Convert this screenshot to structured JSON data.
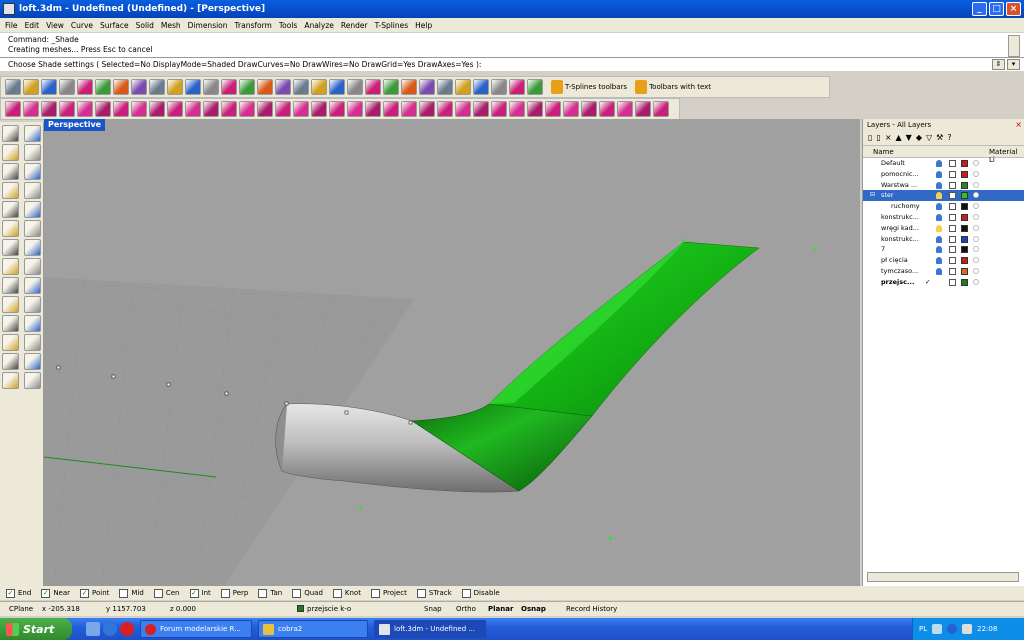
{
  "window": {
    "title": "loft.3dm - Undefined (Undefined) - [Perspective]",
    "buttons": {
      "minimize": "_",
      "maximize": "□",
      "close": "×"
    }
  },
  "menu": [
    "File",
    "Edit",
    "View",
    "Curve",
    "Surface",
    "Solid",
    "Mesh",
    "Dimension",
    "Transform",
    "Tools",
    "Analyze",
    "Render",
    "T-Splines",
    "Help"
  ],
  "command": {
    "history": [
      "Command: _Shade",
      "Creating meshes... Press Esc to cancel"
    ],
    "prompt": "Choose Shade settings ( Selected=No  DisplayMode=Shaded  DrawCurves=No  DrawWires=No  DrawGrid=Yes  DrawAxes=Yes ):"
  },
  "toolbar": {
    "tsplines_label": "T-Splines toolbars",
    "toolbars_with_text_label": "Toolbars with text",
    "row1_icons": [
      "new-icon",
      "open-icon",
      "save-icon",
      "print-icon",
      "properties-icon",
      "cut-icon",
      "copy-icon",
      "paste-icon",
      "undo-icon",
      "pan-icon",
      "rotate-view-icon",
      "zoom-icon",
      "zoom-window-icon",
      "zoom-extents-icon",
      "zoom-selected-icon",
      "four-viewports-icon",
      "select-all-icon",
      "wireframe-car-icon",
      "show-hide-icon",
      "point-on-icon",
      "lock-icon",
      "layer-icon",
      "light-icon",
      "properties-icon",
      "render-icon",
      "sun-icon",
      "shade-sphere-icon",
      "options-icon",
      "gear-icon",
      "help-icon"
    ],
    "row2_icons": [
      "surface-point-icon",
      "box-icon",
      "cylinder-icon",
      "sweep-icon",
      "loft-icon",
      "revolve-icon",
      "patch-icon",
      "network-icon",
      "extrude-icon",
      "rail-icon",
      "blend-icon",
      "fillet-icon",
      "offset-icon",
      "trim-icon",
      "split-icon",
      "join-icon",
      "explode-icon",
      "rebuild-icon",
      "match-icon",
      "extend-icon",
      "merge-icon",
      "unroll-icon",
      "shell-icon",
      "boolean-icon",
      "mesh-icon",
      "cap-icon",
      "edge-icon",
      "chamfer-icon",
      "sphere-icon",
      "torus-icon",
      "flatten-icon",
      "cut-plane-icon",
      "contour-icon",
      "section-icon",
      "isocurve-icon",
      "deform-icon",
      "twist-icon"
    ],
    "colors": {
      "magenta": "#c8207a",
      "yellow": "#e8c020",
      "blue": "#2a62c8"
    }
  },
  "left_tools": [
    "select-arrow-icon",
    "point-icon",
    "polyline-icon",
    "curve-icon",
    "circle-icon",
    "ellipse-icon",
    "arc-icon",
    "rectangle-icon",
    "polygon-icon",
    "fillet-curve-icon",
    "surface-icon",
    "revolve-surface-icon",
    "box-solid-icon",
    "boolean-icon",
    "cylinder-solid-icon",
    "mesh-surface-icon",
    "transform-icon",
    "explode-icon",
    "join-icon",
    "trim-icon",
    "analyze-icon",
    "dimension-icon",
    "move-icon",
    "rotate-icon",
    "text-icon",
    "scale-icon",
    "solid-tools-icon",
    "render-tools-icon"
  ],
  "viewport": {
    "label": "Perspective",
    "colors": {
      "background": "#a0a0a0",
      "grid": "#959595",
      "green_surface": "#15c815",
      "gray_surface": "#c8c8c8"
    }
  },
  "layers": {
    "title": "Layers - All Layers",
    "col_name": "Name",
    "col_material": "Material Li",
    "rows": [
      {
        "name": "Default",
        "color": "#c81e1e",
        "bulb_on": false,
        "selected": false,
        "indent": 0
      },
      {
        "name": "pomocnic...",
        "color": "#c81e1e",
        "bulb_on": false,
        "selected": false,
        "indent": 0
      },
      {
        "name": "Warstwa ...",
        "color": "#1e8c1e",
        "bulb_on": false,
        "selected": false,
        "indent": 0
      },
      {
        "name": "ster",
        "color": "#22c822",
        "bulb_on": true,
        "selected": true,
        "indent": 0
      },
      {
        "name": "ruchomy",
        "color": "#111111",
        "bulb_on": false,
        "selected": false,
        "indent": 1
      },
      {
        "name": "konstrukc...",
        "color": "#c81e1e",
        "bulb_on": false,
        "selected": false,
        "indent": 0
      },
      {
        "name": "wręgi kad...",
        "color": "#111111",
        "bulb_on": true,
        "selected": false,
        "indent": 0
      },
      {
        "name": "konstrukc...",
        "color": "#1e3ec8",
        "bulb_on": false,
        "selected": false,
        "indent": 0
      },
      {
        "name": "7",
        "color": "#111111",
        "bulb_on": false,
        "selected": false,
        "indent": 0
      },
      {
        "name": "pł cięcia",
        "color": "#c81e1e",
        "bulb_on": false,
        "selected": false,
        "indent": 0
      },
      {
        "name": "tymczaso...",
        "color": "#d86a1a",
        "bulb_on": false,
        "selected": false,
        "indent": 0
      },
      {
        "name": "przejsc...",
        "color": "#1e7c1e",
        "bulb_on": false,
        "selected": false,
        "indent": 0,
        "current": true
      }
    ],
    "current_mark": "✓"
  },
  "osnap": [
    {
      "label": "End",
      "checked": true
    },
    {
      "label": "Near",
      "checked": true
    },
    {
      "label": "Point",
      "checked": true
    },
    {
      "label": "Mid",
      "checked": false
    },
    {
      "label": "Cen",
      "checked": false
    },
    {
      "label": "Int",
      "checked": true
    },
    {
      "label": "Perp",
      "checked": false
    },
    {
      "label": "Tan",
      "checked": false
    },
    {
      "label": "Quad",
      "checked": false
    },
    {
      "label": "Knot",
      "checked": false
    },
    {
      "label": "Project",
      "checked": false
    },
    {
      "label": "STrack",
      "checked": false
    },
    {
      "label": "Disable",
      "checked": false
    }
  ],
  "status": {
    "cplane": "CPlane",
    "x": "x -205.318",
    "y": "y 1157.703",
    "z": "z 0.000",
    "layer": "przejscie k-o",
    "snap": "Snap",
    "ortho": "Ortho",
    "planar": "Planar",
    "osnap": "Osnap",
    "record": "Record History"
  },
  "taskbar": {
    "start": "Start",
    "tasks": [
      {
        "label": "Forum modelarskie R...",
        "active": false
      },
      {
        "label": "cobra2",
        "active": false
      },
      {
        "label": "loft.3dm - Undefined ...",
        "active": true
      }
    ],
    "lang": "PL",
    "clock": "22:08"
  },
  "check_glyph": "✓"
}
